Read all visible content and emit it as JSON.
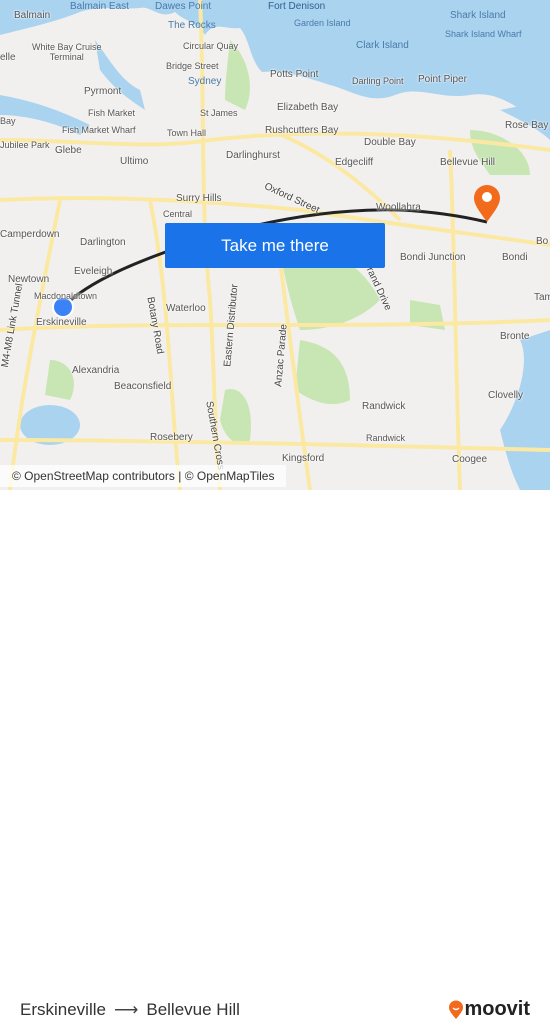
{
  "map": {
    "labels": {
      "balmain": "Balmain",
      "balmain_east": "Balmain East",
      "dawes_point": "Dawes Point",
      "the_rocks": "The Rocks",
      "circular_quay": "Circular Quay",
      "bridge_street": "Bridge Street",
      "sydney": "Sydney",
      "st_james": "St James",
      "town_hall": "Town Hall",
      "pyrmont": "Pyrmont",
      "fish_market": "Fish Market",
      "fish_market_wharf": "Fish Market Wharf",
      "jubilee_park": "Jubilee Park",
      "glebe": "Glebe",
      "ultimo": "Ultimo",
      "white_bay": "White Bay Cruise\nTerminal",
      "elle": "elle",
      "bay": "Bay",
      "darlinghurst": "Darlinghurst",
      "surry_hills": "Surry Hills",
      "central": "Central",
      "camperdown": "Camperdown",
      "darlington": "Darlington",
      "newtown": "Newtown",
      "eveleigh": "Eveleigh",
      "macdonaldtown": "Macdonaldtown",
      "erskineville": "Erskineville",
      "alexandria": "Alexandria",
      "beaconsfield": "Beaconsfield",
      "waterloo": "Waterloo",
      "botany_road": "Botany Road",
      "eastern_distributor": "Eastern Distributor",
      "southern_cross": "Southern Cross",
      "anzac_parade": "Anzac Parade",
      "rosebery": "Rosebery",
      "kingsford": "Kingsford",
      "randwick": "Randwick",
      "randwick2": "Randwick",
      "m4_m8": "M4-M8 Link Tunnel",
      "oxford_street": "Oxford Street",
      "grand_drive": "Grand Drive",
      "potts_point": "Potts Point",
      "elizabeth_bay": "Elizabeth Bay",
      "rushcutters_bay": "Rushcutters Bay",
      "edgecliff": "Edgecliff",
      "double_bay": "Double Bay",
      "darling_point": "Darling Point",
      "point_piper": "Point Piper",
      "clark_island": "Clark Island",
      "garden_island": "Garden Island",
      "port_denison": "Fort Denison",
      "shark_island": "Shark Island",
      "shark_island_wharf": "Shark Island Wharf",
      "rose_bay": "Rose Bay",
      "bellevue_hill": "Bellevue Hill",
      "woollahra": "Woollahra",
      "bondi_junction": "Bondi Junction",
      "bondi": "Bondi",
      "bo": "Bo",
      "tam": "Tam",
      "bronte": "Bronte",
      "clovelly": "Clovelly",
      "coogee": "Coogee"
    },
    "take_me_there": "Take me there",
    "attribution": "© OpenStreetMap contributors | © OpenMapTiles",
    "colors": {
      "water": "#aad3f0",
      "park": "#c8e6b4",
      "road": "#fbe9a3",
      "route": "#222222",
      "button": "#1a73e8",
      "origin": "#3b82f6",
      "destination": "#f26a1b"
    }
  },
  "footer": {
    "origin": "Erskineville",
    "arrow": "⟶",
    "destination": "Bellevue Hill",
    "brand": "moovit"
  }
}
